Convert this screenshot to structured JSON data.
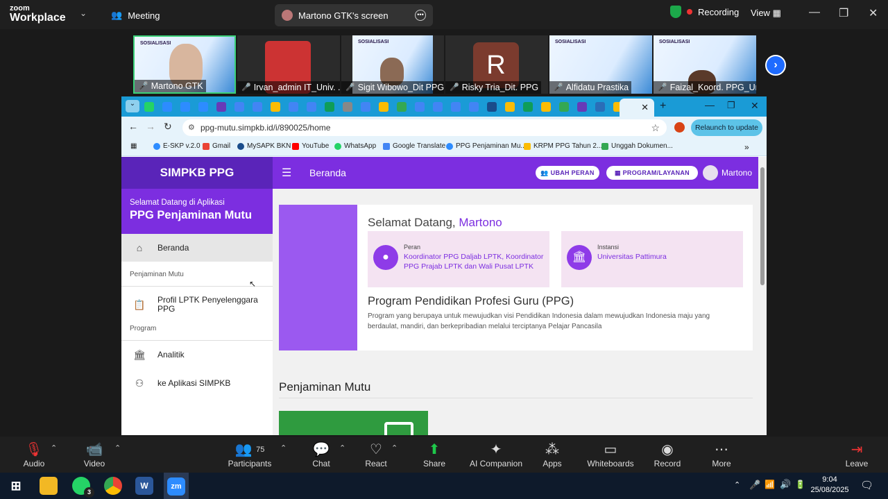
{
  "zoom": {
    "logo_top": "zoom",
    "logo_bottom": "Workplace",
    "tab_meeting": "Meeting",
    "tab_screen": "Martono GTK's screen",
    "recording": "Recording",
    "view": "View"
  },
  "participants": [
    {
      "name": "Martono GTK"
    },
    {
      "name": "Irvan_admin IT_Univ. ..."
    },
    {
      "name": "Sigit Wibowo_Dit PPG..."
    },
    {
      "name": "Risky Tria_Dit. PPG",
      "initial": "R"
    },
    {
      "name": "Alfidatu Prastika"
    },
    {
      "name": "Faizal_Koord. PPG_Un..."
    }
  ],
  "slide_text": "SOSIALISASI",
  "browser": {
    "url": "ppg-mutu.simpkb.id/i/890025/home",
    "relaunch": "Relaunch to update",
    "bookmarks": [
      "E-SKP v.2.0",
      "Gmail",
      "MySAPK BKN",
      "YouTube",
      "WhatsApp",
      "Google Translate",
      "PPG Penjaminan Mu...",
      "KRPM PPG Tahun 2...",
      "Unggah Dokumen..."
    ]
  },
  "site": {
    "brand": "SIMPKB PPG",
    "welcome_small": "Selamat Datang di Aplikasi",
    "welcome_big": "PPG Penjaminan Mutu",
    "menu_beranda": "Beranda",
    "sec_penjaminan": "Penjaminan Mutu",
    "menu_profil": "Profil LPTK Penyelenggara PPG",
    "sec_program": "Program",
    "menu_analitik": "Analitik",
    "menu_aplikasi": "ke Aplikasi SIMPKB",
    "topbar_title": "Beranda",
    "btn_ubah": "UBAH PERAN",
    "btn_program": "PROGRAM/LAYANAN",
    "user": "Martono",
    "greet_prefix": "Selamat Datang,",
    "greet_name": "Martono",
    "peran_label": "Peran",
    "peran_value": "Koordinator PPG Daljab LPTK, Koordinator PPG Prajab LPTK dan Wali Pusat LPTK",
    "instansi_label": "Instansi",
    "instansi_value": "Universitas Pattimura",
    "ppg_title": "Program Pendidikan Profesi Guru (PPG)",
    "ppg_desc": "Program yang berupaya untuk mewujudkan visi Pendidikan Indonesia dalam mewujudkan Indonesia maju yang berdaulat, mandiri, dan berkepribadian melalui terciptanya Pelajar Pancasila",
    "pm_title": "Penjaminan Mutu"
  },
  "toolbar": {
    "audio": "Audio",
    "video": "Video",
    "participants": "Participants",
    "participants_count": "75",
    "chat": "Chat",
    "react": "React",
    "share": "Share",
    "ai": "AI Companion",
    "apps": "Apps",
    "whiteboards": "Whiteboards",
    "record": "Record",
    "more": "More",
    "leave": "Leave"
  },
  "taskbar": {
    "whatsapp_badge": "3",
    "time": "9:04",
    "date": "25/08/2025"
  }
}
